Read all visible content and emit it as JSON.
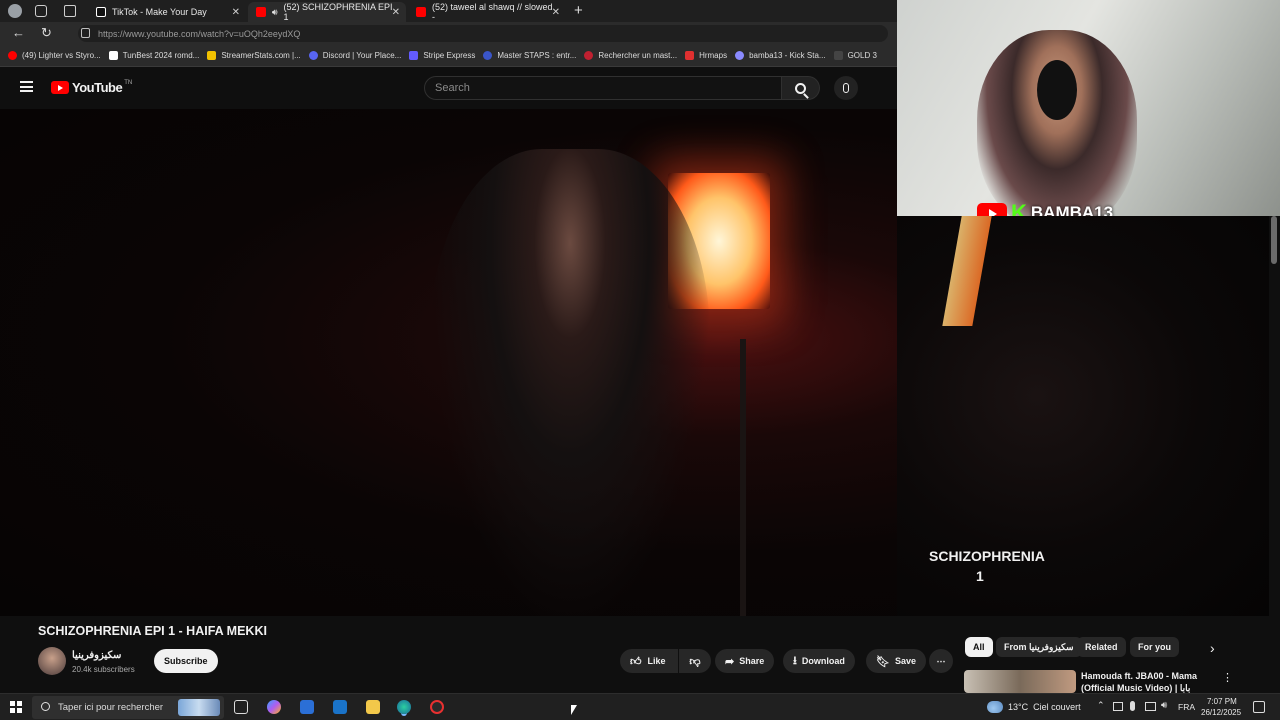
{
  "browser": {
    "tabs": [
      {
        "label": "TikTok - Make Your Day",
        "active": false
      },
      {
        "label": "(52) SCHIZOPHRENIA EPI 1",
        "active": true
      },
      {
        "label": "(52) taweel al shawq // slowed -",
        "active": false
      }
    ],
    "url": "https://www.youtube.com/watch?v=uOQh2eeydXQ",
    "bookmarks": [
      "(49) Lighter vs Styro...",
      "TunBest 2024 romd...",
      "StreamerStats.com |...",
      "Discord | Your Place...",
      "Stripe Express",
      "Master STAPS : entr...",
      "Rechercher un mast...",
      "Hrmaps",
      "bamba13 - Kick Sta...",
      "GOLD 3"
    ]
  },
  "youtube": {
    "logo": "YouTube",
    "country": "TN",
    "search_placeholder": "Search"
  },
  "video": {
    "title": "SCHIZOPHRENIA EPI 1 - HAIFA MEKKI",
    "channel": "سكيزوفرينيا",
    "subscribers": "20.4k subscribers",
    "subscribe_label": "Subscribe",
    "like_label": "Like",
    "share_label": "Share",
    "download_label": "Download",
    "save_label": "Save",
    "overlay_line1": "SCHIZOPHRENIA",
    "overlay_line2": "1"
  },
  "stream": {
    "brand": "BAMBA13",
    "platform_k": "K"
  },
  "chips": [
    "All",
    "From سكيزوفرينيا",
    "Related",
    "For you"
  ],
  "recommendation": {
    "line1": "Hamouda ft. JBA00 - Mama",
    "line2": "(Official Music Video) | بابا"
  },
  "taskbar": {
    "search_placeholder": "Taper ici pour rechercher",
    "weather": "13°C  Ciel couvert",
    "lang": "FRA",
    "time": "7:07 PM",
    "date": "26/12/2025"
  },
  "colors": {
    "yt_red": "#ff0000",
    "kick_green": "#53fc18",
    "chip_active_bg": "#f1f1f1"
  }
}
